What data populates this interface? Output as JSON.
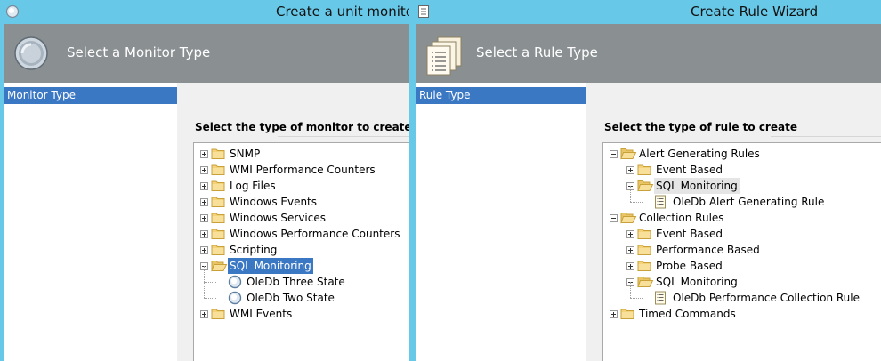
{
  "left_window": {
    "title": "Create a unit monitor",
    "header_title": "Select a Monitor Type",
    "sidebar_item": "Monitor Type",
    "section_title": "Select the type of monitor to create",
    "tree": [
      {
        "label": "SNMP",
        "icon": "folder-icon",
        "expander": "plus"
      },
      {
        "label": "WMI Performance Counters",
        "icon": "folder-icon",
        "expander": "plus"
      },
      {
        "label": "Log Files",
        "icon": "folder-icon",
        "expander": "plus"
      },
      {
        "label": "Windows Events",
        "icon": "folder-icon",
        "expander": "plus"
      },
      {
        "label": "Windows Services",
        "icon": "folder-icon",
        "expander": "plus"
      },
      {
        "label": "Windows Performance Counters",
        "icon": "folder-icon",
        "expander": "plus"
      },
      {
        "label": "Scripting",
        "icon": "folder-icon",
        "expander": "plus"
      },
      {
        "label": "SQL Monitoring",
        "icon": "open-folder-icon",
        "expander": "minus",
        "selected": true
      },
      {
        "label": "OleDb Three State",
        "icon": "monitor-circle-icon"
      },
      {
        "label": "OleDb Two State",
        "icon": "monitor-circle-icon"
      },
      {
        "label": "WMI Events",
        "icon": "folder-icon",
        "expander": "plus"
      }
    ]
  },
  "right_window": {
    "title": "Create Rule Wizard",
    "header_title": "Select a Rule Type",
    "sidebar_item": "Rule Type",
    "section_title": "Select the type of rule to create",
    "tree": [
      {
        "label": "Alert Generating Rules",
        "icon": "open-folder-icon",
        "expander": "minus"
      },
      {
        "label": "Event Based",
        "icon": "folder-icon",
        "expander": "plus"
      },
      {
        "label": "SQL Monitoring",
        "icon": "open-folder-icon",
        "expander": "minus",
        "hover": true
      },
      {
        "label": "OleDb Alert Generating Rule",
        "icon": "rule-document-icon"
      },
      {
        "label": "Collection Rules",
        "icon": "open-folder-icon",
        "expander": "minus"
      },
      {
        "label": "Event Based",
        "icon": "folder-icon",
        "expander": "plus"
      },
      {
        "label": "Performance Based",
        "icon": "folder-icon",
        "expander": "plus"
      },
      {
        "label": "Probe Based",
        "icon": "folder-icon",
        "expander": "plus"
      },
      {
        "label": "SQL Monitoring",
        "icon": "open-folder-icon",
        "expander": "minus"
      },
      {
        "label": "OleDb Performance Collection Rule",
        "icon": "rule-document-icon"
      },
      {
        "label": "Timed Commands",
        "icon": "folder-icon",
        "expander": "plus"
      }
    ]
  },
  "colors": {
    "titlebar": "#68c8e8",
    "header": "#8a8f92",
    "selection": "#3b78c4",
    "folder": "#f3d27a"
  }
}
